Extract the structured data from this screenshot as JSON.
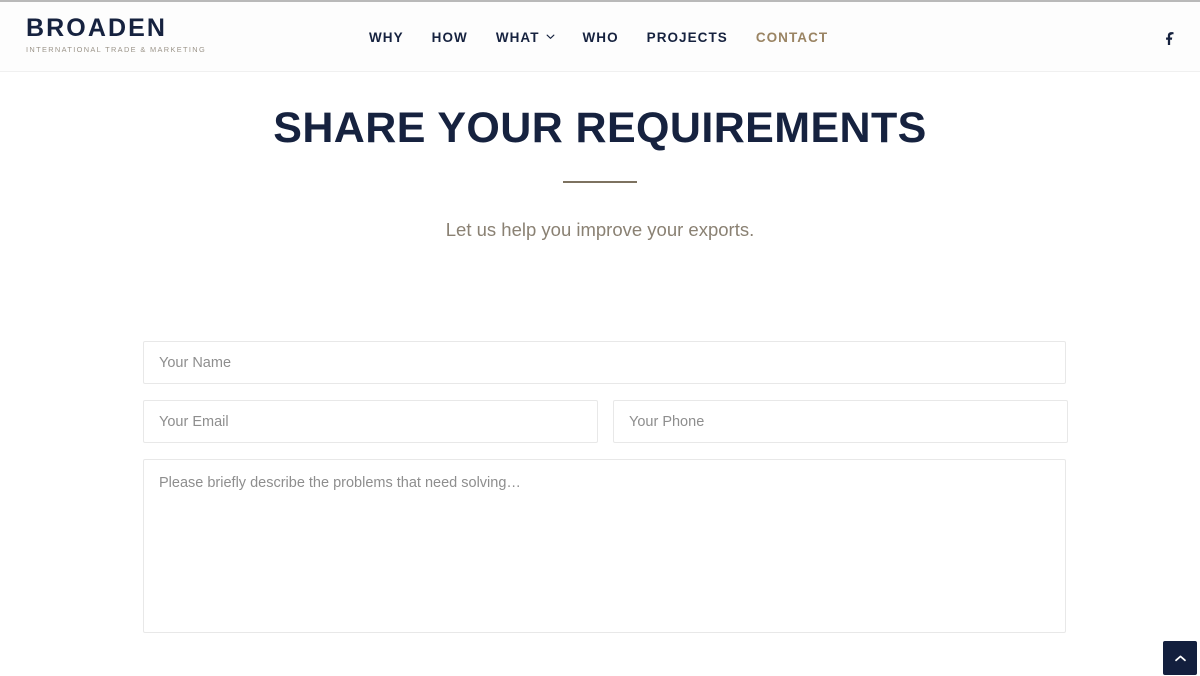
{
  "brand": {
    "name": "BROADEN",
    "tagline": "INTERNATIONAL TRADE & MARKETING",
    "color": "#16223f",
    "tagline_color": "#9c958a"
  },
  "header": {
    "background": "#fdfdfd",
    "border_color": "#f0f0f0",
    "nav": [
      {
        "label": "WHY",
        "active": false,
        "has_dropdown": false
      },
      {
        "label": "HOW",
        "active": false,
        "has_dropdown": false
      },
      {
        "label": "WHAT",
        "active": false,
        "has_dropdown": true
      },
      {
        "label": "WHO",
        "active": false,
        "has_dropdown": false
      },
      {
        "label": "PROJECTS",
        "active": false,
        "has_dropdown": false
      },
      {
        "label": "CONTACT",
        "active": true,
        "has_dropdown": false
      }
    ],
    "active_color": "#9a8463",
    "social": [
      {
        "name": "facebook",
        "icon": "facebook-icon",
        "glyph": "f"
      }
    ]
  },
  "hero": {
    "title": "SHARE YOUR REQUIREMENTS",
    "title_color": "#16223f",
    "divider_color": "#7d7260",
    "subtitle": "Let us help you improve your exports.",
    "subtitle_color": "#8a8173"
  },
  "form": {
    "fields": {
      "name_placeholder": "Your Name",
      "name_value": "",
      "email_placeholder": "Your Email",
      "email_value": "",
      "phone_placeholder": "Your Phone",
      "phone_value": "",
      "message_placeholder": "Please briefly describe the problems that need solving…",
      "message_value": ""
    },
    "border_color": "#e8e8e8",
    "placeholder_color": "#8e8e8e"
  },
  "back_to_top": {
    "icon": "chevron-up-icon",
    "background": "#131f3e"
  }
}
